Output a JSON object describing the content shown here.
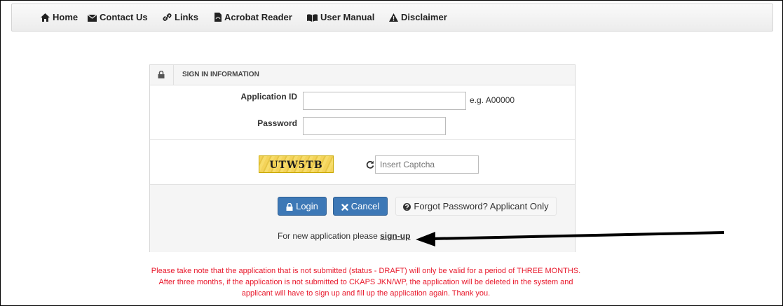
{
  "nav": {
    "home": "Home",
    "contact": "Contact Us",
    "links": "Links",
    "acrobat": "Acrobat Reader",
    "manual": "User Manual",
    "disclaimer": "Disclaimer"
  },
  "signin": {
    "title": "SIGN IN INFORMATION",
    "app_id_label": "Application ID",
    "app_id_value": "",
    "app_id_hint": "e.g. A00000",
    "password_label": "Password",
    "password_value": "",
    "captcha_text": "UTW5TB",
    "captcha_placeholder": "Insert Captcha"
  },
  "actions": {
    "login": "Login",
    "cancel": "Cancel",
    "forgot": "Forgot Password? Applicant Only",
    "signup_prefix": "For new application please ",
    "signup_link": "sign-up"
  },
  "notice": "Please take note that the application that is not submitted (status - DRAFT) will only be valid for a period of THREE MONTHS. After three months, if the application is not submitted to CKAPS JKN/WP, the application will be deleted in the system and applicant will have to sign up and fill up the application again. Thank you.",
  "icons": [
    "home-icon",
    "envelope-icon",
    "link-icon",
    "pdf-file-icon",
    "book-icon",
    "warning-icon",
    "lock-icon",
    "refresh-icon",
    "question-icon",
    "times-icon"
  ]
}
